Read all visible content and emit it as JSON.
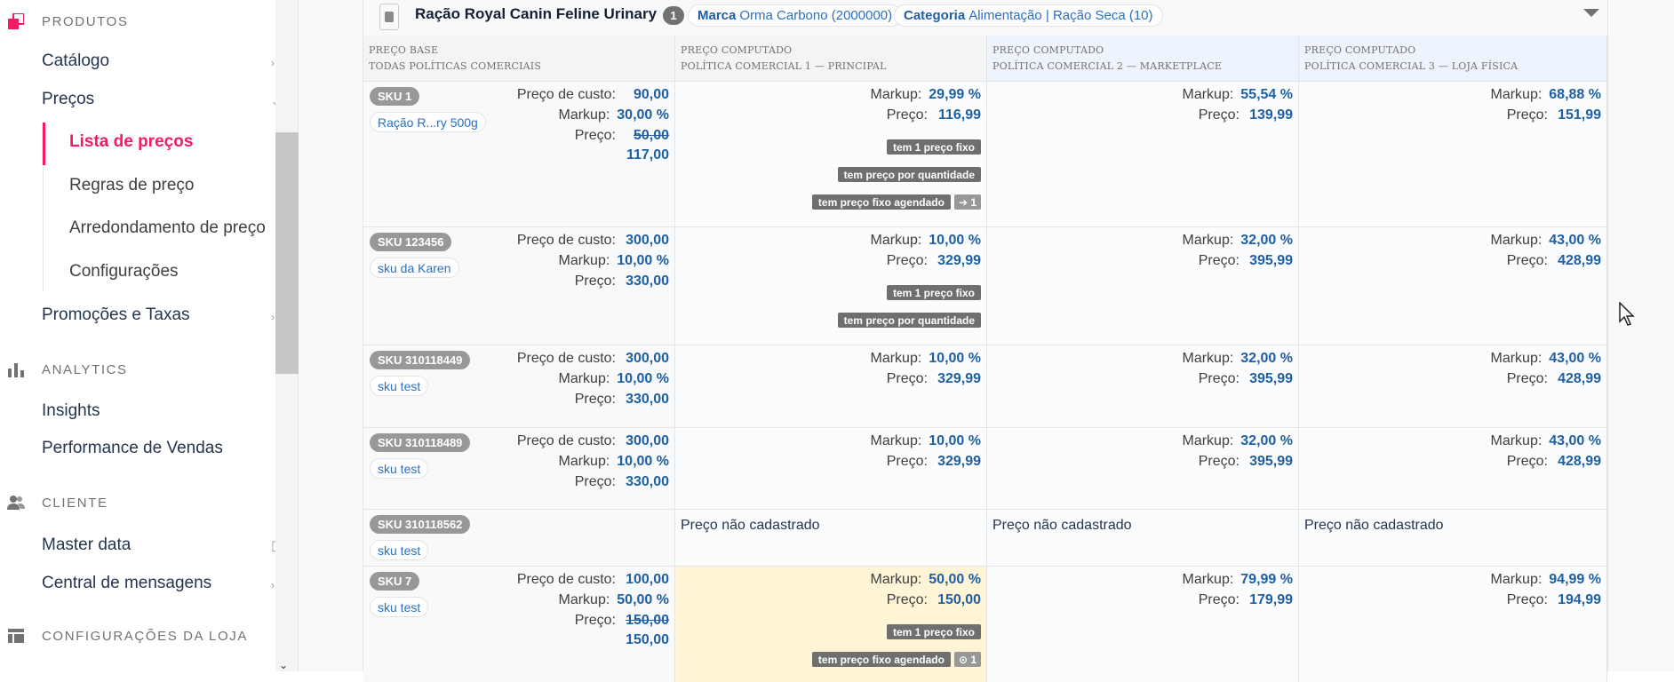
{
  "sidebar": {
    "groups": [
      {
        "label": "PRODUTOS",
        "icon": "products-icon"
      },
      {
        "label": "ANALYTICS",
        "icon": "bar-chart-icon"
      },
      {
        "label": "CLIENTE",
        "icon": "users-icon"
      },
      {
        "label": "CONFIGURAÇÕES DA LOJA",
        "icon": "store-layout-icon"
      }
    ],
    "items": {
      "catalogo": "Catálogo",
      "precos": "Preços",
      "promocoes": "Promoções e Taxas",
      "insights": "Insights",
      "performance": "Performance de Vendas",
      "master_data": "Master data",
      "central": "Central de mensagens"
    },
    "sub_items": {
      "lista": "Lista de preços",
      "regras": "Regras de preço",
      "arredondamento": "Arredondamento de preço",
      "configuracoes": "Configurações"
    }
  },
  "product": {
    "name": "Ração Royal Canin Feline Urinary",
    "sku_count": "1",
    "brand_label": "Marca",
    "brand_value": "Orma Carbono (2000000)",
    "category_label": "Categoria",
    "category_value": "Alimentação | Ração Seca (10)"
  },
  "columns": [
    {
      "line1": "PREÇO BASE",
      "line2": "TODAS POLÍTICAS COMERCIAIS"
    },
    {
      "line1": "PREÇO COMPUTADO",
      "line2": "POLÍTICA COMERCIAL 1 — PRINCIPAL"
    },
    {
      "line1": "PREÇO COMPUTADO",
      "line2": "POLÍTICA COMERCIAL 2 — MARKETPLACE"
    },
    {
      "line1": "PREÇO COMPUTADO",
      "line2": "POLÍTICA COMERCIAL 3 — LOJA FÍSICA"
    }
  ],
  "labels": {
    "cost": "Preço de custo:",
    "markup": "Markup:",
    "price": "Preço:",
    "not_registered": "Preço não cadastrado",
    "flag_fixed": "tem 1 preço fixo",
    "flag_qty": "tem preço por quantidade",
    "flag_scheduled": "tem preço fixo agendado"
  },
  "rows": [
    {
      "sku": "SKU 1",
      "name": "Ração R...ry 500g",
      "cost": "90,00",
      "markup": "30,00 %",
      "price_old": "50,00",
      "price": "117,00",
      "pc1": {
        "markup": "29,99 %",
        "price": "116,99",
        "sched_count": "➔ 1"
      },
      "pc2": {
        "markup": "55,54 %",
        "price": "139,99"
      },
      "pc3": {
        "markup": "68,88 %",
        "price": "151,99"
      }
    },
    {
      "sku": "SKU 123456",
      "name": "sku da Karen",
      "cost": "300,00",
      "markup": "10,00 %",
      "price": "330,00",
      "pc1": {
        "markup": "10,00 %",
        "price": "329,99"
      },
      "pc2": {
        "markup": "32,00 %",
        "price": "395,99"
      },
      "pc3": {
        "markup": "43,00 %",
        "price": "428,99"
      }
    },
    {
      "sku": "SKU 310118449",
      "name": "sku test",
      "cost": "300,00",
      "markup": "10,00 %",
      "price": "330,00",
      "pc1": {
        "markup": "10,00 %",
        "price": "329,99"
      },
      "pc2": {
        "markup": "32,00 %",
        "price": "395,99"
      },
      "pc3": {
        "markup": "43,00 %",
        "price": "428,99"
      }
    },
    {
      "sku": "SKU 310118489",
      "name": "sku test",
      "cost": "300,00",
      "markup": "10,00 %",
      "price": "330,00",
      "pc1": {
        "markup": "10,00 %",
        "price": "329,99"
      },
      "pc2": {
        "markup": "32,00 %",
        "price": "395,99"
      },
      "pc3": {
        "markup": "43,00 %",
        "price": "428,99"
      }
    },
    {
      "sku": "SKU 310118562",
      "name": "sku test"
    },
    {
      "sku": "SKU 7",
      "name": "sku test",
      "cost": "100,00",
      "markup": "50,00 %",
      "price_old": "150,00",
      "price": "150,00",
      "pc1": {
        "markup": "50,00 %",
        "price": "150,00",
        "sched_count": "⊙ 1"
      },
      "pc2": {
        "markup": "79,99 %",
        "price": "179,99"
      },
      "pc3": {
        "markup": "94,99 %",
        "price": "194,99"
      }
    }
  ],
  "colors": {
    "accent": "#f71963",
    "link": "#1f5fa3",
    "highlight": "#fff5d6"
  }
}
